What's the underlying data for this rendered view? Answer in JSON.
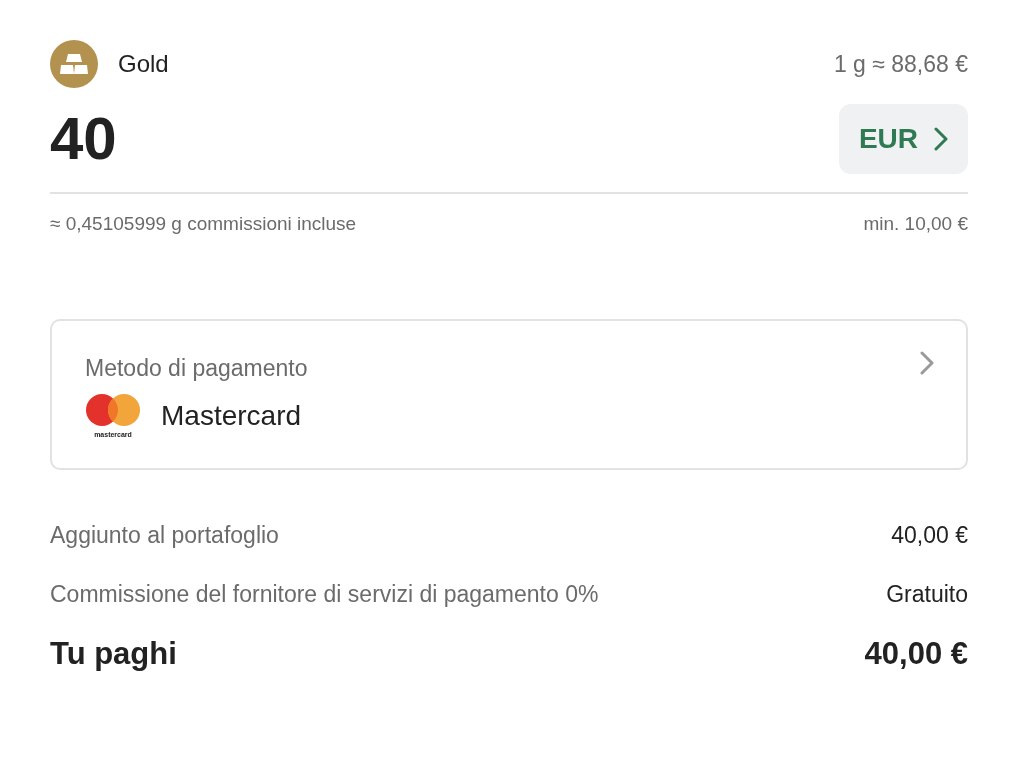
{
  "asset": {
    "name": "Gold",
    "rate": "1 g ≈ 88,68 €"
  },
  "amount": {
    "value": "40",
    "currency": "EUR",
    "estimate": "≈ 0,45105999 g commissioni incluse",
    "minimum": "min. 10,00 €"
  },
  "payment_method": {
    "label": "Metodo di pagamento",
    "logo_caption": "mastercard",
    "name": "Mastercard"
  },
  "summary": [
    {
      "label": "Aggiunto al portafoglio",
      "value": "40,00 €",
      "kind": "line"
    },
    {
      "label": "Commissione del fornitore di servizi di pagamento 0%",
      "value": "Gratuito",
      "kind": "line"
    },
    {
      "label": "Tu paghi",
      "value": "40,00 €",
      "kind": "total"
    }
  ]
}
